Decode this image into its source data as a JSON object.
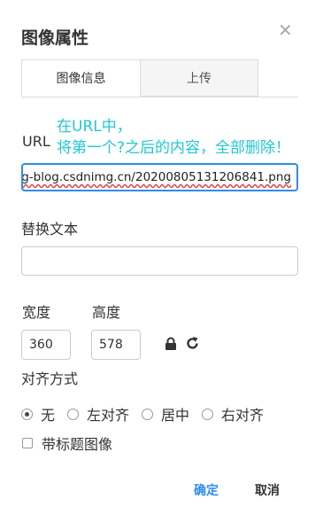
{
  "dialog": {
    "title": "图像属性",
    "close_icon": "close-icon"
  },
  "tabs": [
    {
      "label": "图像信息",
      "active": true
    },
    {
      "label": "上传",
      "active": false
    }
  ],
  "url": {
    "label": "URL",
    "value": "g-blog.csdnimg.cn/20200805131206841.png",
    "annotation_line1": "在URL中，",
    "annotation_line2": "将第一个?之后的内容，全部删除！",
    "annotation_color": "#21c7d4"
  },
  "alt_text": {
    "label": "替换文本",
    "value": ""
  },
  "width": {
    "label": "宽度",
    "value": "360"
  },
  "height": {
    "label": "高度",
    "value": "578"
  },
  "align": {
    "label": "对齐方式",
    "options": [
      {
        "label": "无",
        "checked": true
      },
      {
        "label": "左对齐",
        "checked": false
      },
      {
        "label": "居中",
        "checked": false
      },
      {
        "label": "右对齐",
        "checked": false
      }
    ]
  },
  "caption": {
    "label": "带标题图像",
    "checked": false
  },
  "buttons": {
    "ok": "确定",
    "cancel": "取消"
  },
  "colors": {
    "accent": "#2d8cf0"
  }
}
